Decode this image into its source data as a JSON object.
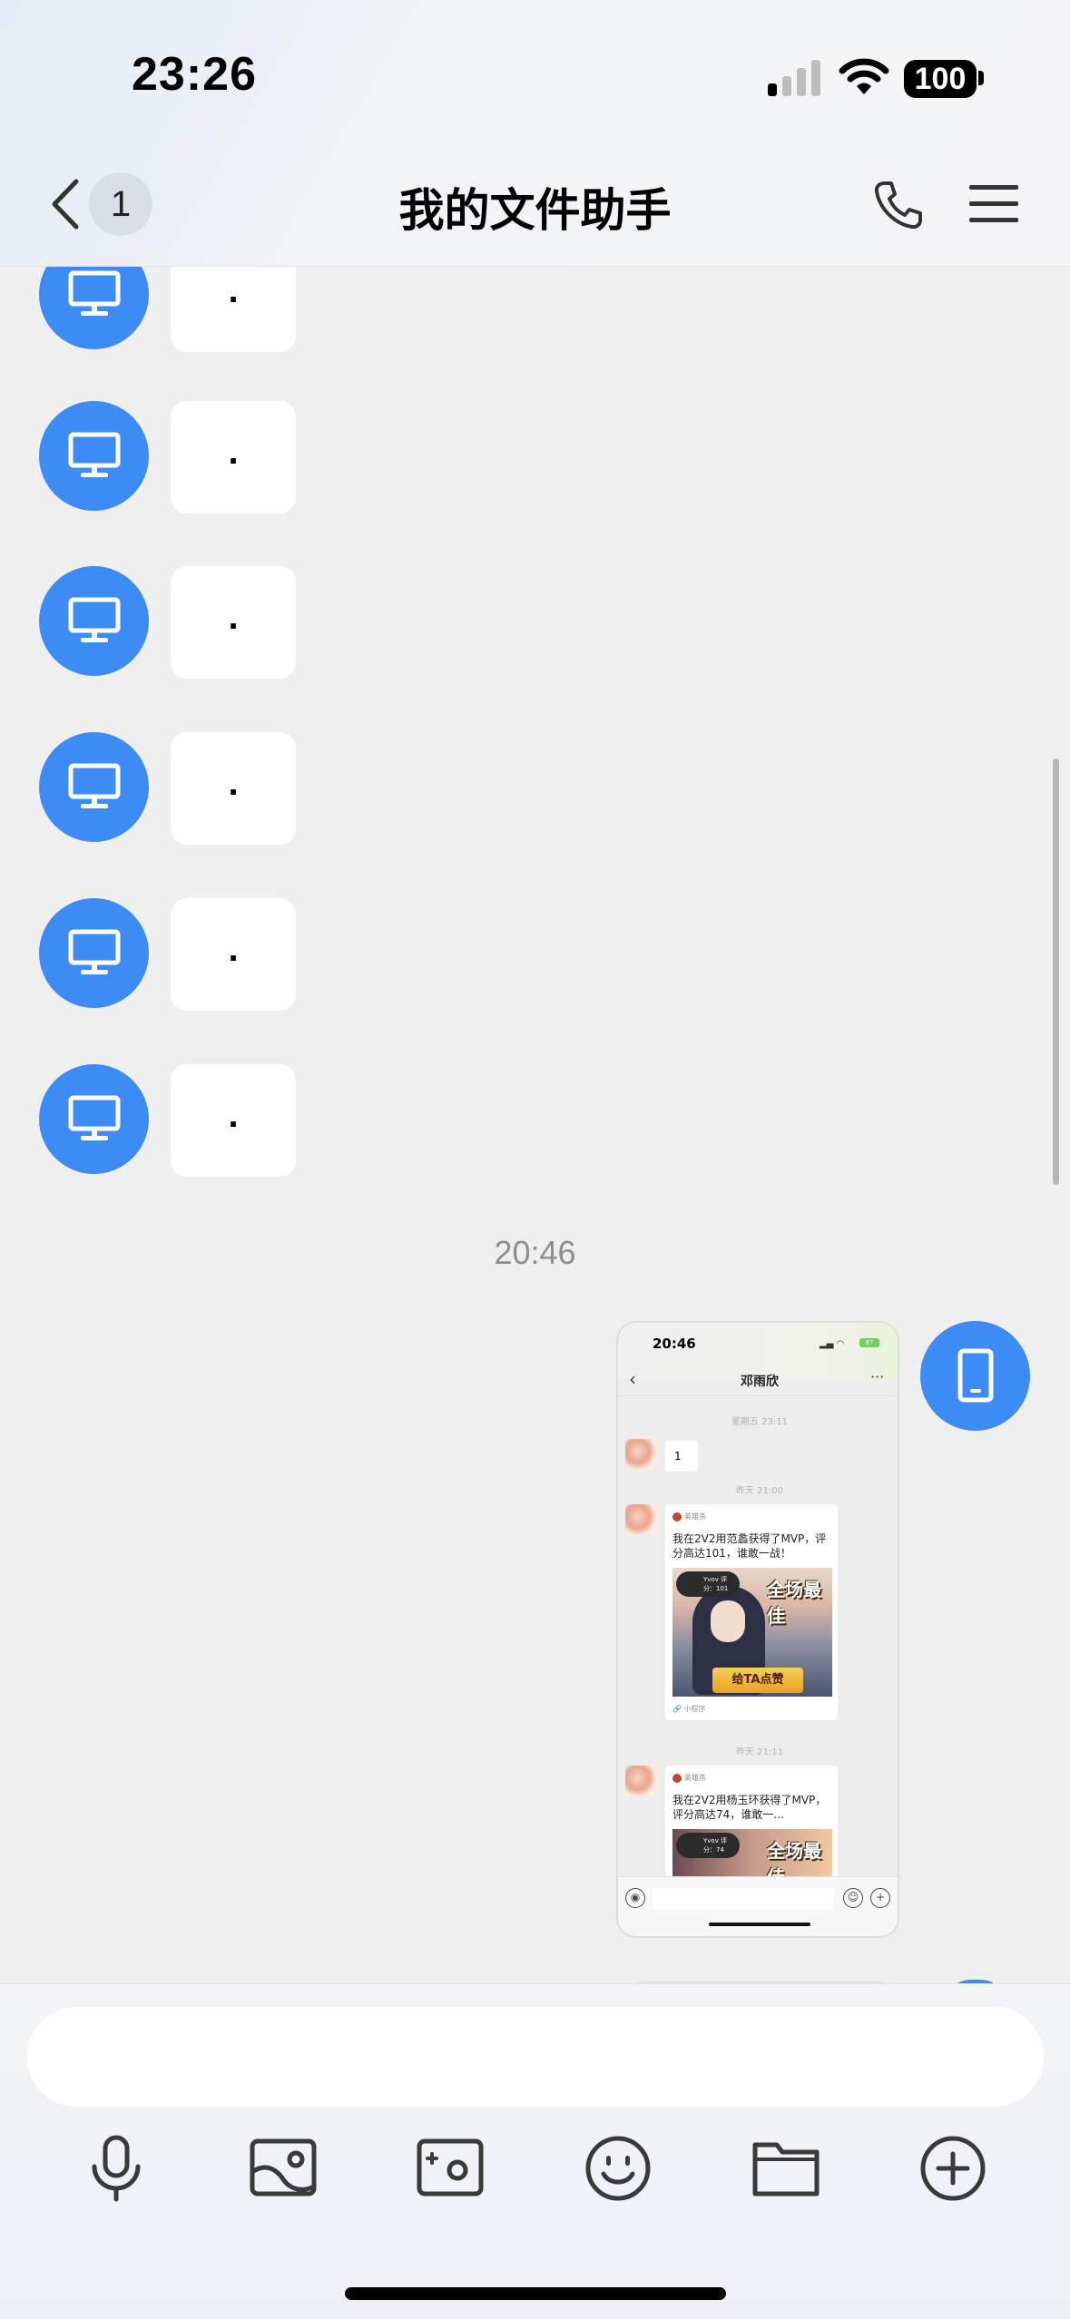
{
  "status_bar": {
    "time": "23:26",
    "battery": "100"
  },
  "header": {
    "back_badge": "1",
    "title": "我的文件助手"
  },
  "messages": [
    {
      "sender": "computer",
      "text": "."
    },
    {
      "sender": "computer",
      "text": "."
    },
    {
      "sender": "computer",
      "text": "."
    },
    {
      "sender": "computer",
      "text": "."
    },
    {
      "sender": "computer",
      "text": "."
    },
    {
      "sender": "computer",
      "text": "."
    }
  ],
  "timestamp": "20:46",
  "screenshot_message": {
    "time": "20:46",
    "battery": "87",
    "chat_title": "邓雨欣",
    "more": "···",
    "ts1": "星期五 23:11",
    "msg1": "1",
    "ts2": "昨天 21:00",
    "card1": {
      "source": "英雄杀",
      "text": "我在2V2用范蠡获得了MVP，评分高达101，谁敢一战！",
      "badge": "Yvov 评分：101",
      "mvp": "全场最佳",
      "like": "给TA点赞",
      "mini": "小程序"
    },
    "ts3": "昨天 21:11",
    "card2": {
      "source": "英雄杀",
      "text": "我在2V2用杨玉环获得了MVP，评分高达74，谁敢一...",
      "badge": "Yvov 评分：74",
      "mvp": "全场最佳"
    }
  },
  "input": {
    "placeholder": ""
  },
  "toolbar": [
    "microphone-icon",
    "image-icon",
    "camera-icon",
    "emoji-icon",
    "folder-icon",
    "plus-icon"
  ],
  "colors": {
    "accent": "#3d8cf5",
    "background": "#efefef",
    "bubble": "#ffffff"
  }
}
